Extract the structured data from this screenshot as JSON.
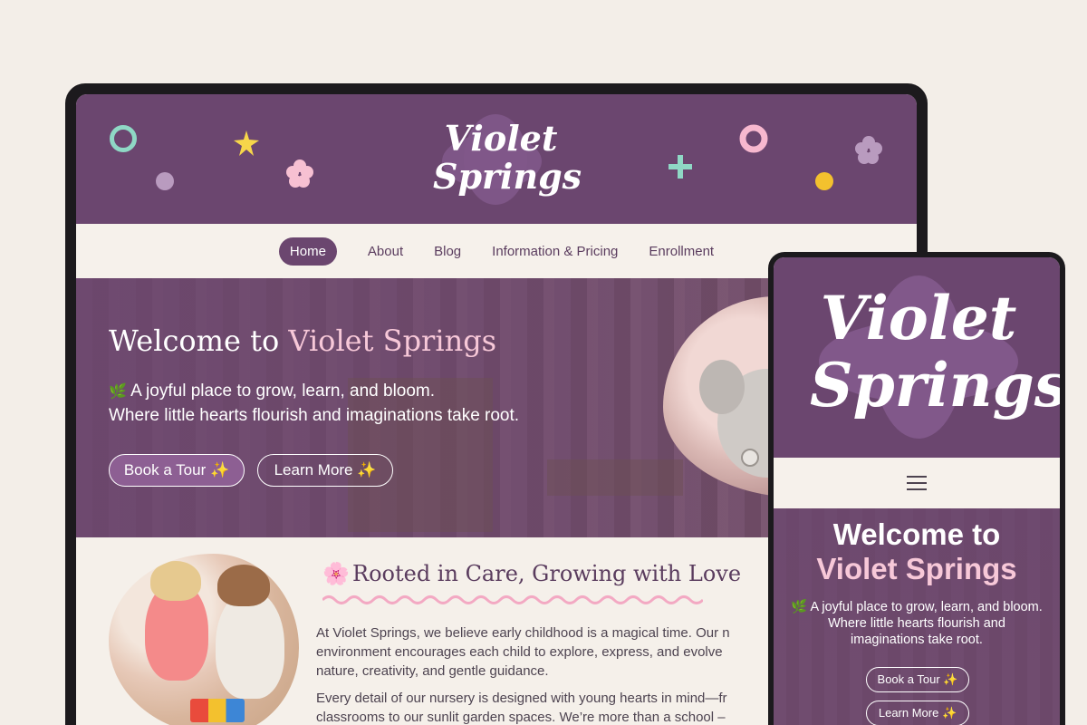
{
  "brand": {
    "line1": "Violet",
    "line2": "Springs"
  },
  "colors": {
    "primary": "#6b466f",
    "accent_pink": "#f7c8d8",
    "background": "#f3eee8"
  },
  "nav": {
    "items": [
      {
        "label": "Home",
        "active": true
      },
      {
        "label": "About"
      },
      {
        "label": "Blog"
      },
      {
        "label": "Information & Pricing"
      },
      {
        "label": "Enrollment"
      }
    ]
  },
  "hero": {
    "title_prefix": "Welcome to",
    "title_highlight": "Violet Springs",
    "leaf_icon": "🌿",
    "tagline_line1": "A joyful place to grow, learn, and bloom.",
    "tagline_line2": "Where little hearts flourish and imaginations take root.",
    "primary_button": "Book a Tour ✨",
    "secondary_button": "Learn More ✨"
  },
  "about": {
    "flower_icon": "🌸",
    "title": "Rooted in Care, Growing with Love",
    "paragraph1": [
      "At Violet Springs, we believe early childhood is a magical time. Our n",
      "environment encourages each child to explore, express, and evolve",
      "nature, creativity, and gentle guidance."
    ],
    "paragraph2": [
      "Every detail of our nursery is designed with young hearts in mind—fr",
      "classrooms to our sunlit garden spaces. We’re more than a school –"
    ]
  },
  "mobile": {
    "title_line1": "Welcome to",
    "title_line2": "Violet Springs",
    "tagline": [
      "🌿 A joyful place to grow, learn, and bloom.",
      "Where little hearts flourish and",
      "imaginations take root."
    ],
    "primary_button": "Book a Tour ✨",
    "secondary_button": "Learn More ✨"
  }
}
